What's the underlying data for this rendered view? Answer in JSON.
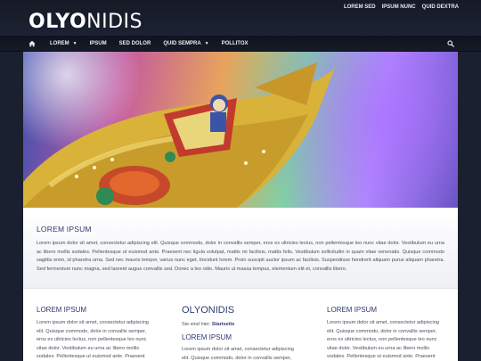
{
  "header": {
    "logo_bold": "OLYO",
    "logo_light": "NIDIS",
    "top_links": [
      "LOREM SED",
      "IPSUM NUNC",
      "QUID DEXTRA"
    ]
  },
  "nav": {
    "items": [
      {
        "label": "LOREM",
        "has_dropdown": true
      },
      {
        "label": "IPSUM",
        "has_dropdown": false
      },
      {
        "label": "SED DOLOR",
        "has_dropdown": false
      },
      {
        "label": "QUID SEMPRA",
        "has_dropdown": true
      },
      {
        "label": "POLLITOX",
        "has_dropdown": false
      }
    ],
    "home_icon": "home-icon",
    "search_icon": "search-icon"
  },
  "intro": {
    "heading": "LOREM IPSUM",
    "body": "Lorem ipsum dolor sit amet, consectetur adipiscing elit. Quisque commodo, dolor in convallis semper, eros ex ultricies lectus, non pellentesque leo nunc vitae dolor. Vestibulum eu urna ac libero mollis sodales. Pellentesque ut euismod ante. Praesent nec ligula volutpat, mattis mi facilisis, mattis felis. Vestibulum sollicitudin in quam vitae venenatis. Quisque commodo sagittis enim, id pharetra urna. Sed nec mauris tempor, varius nunc eget, tincidunt lorem. Proin suscipit auctor ipsum ac facilisis. Suspendisse hendrerit aliquam purus aliquam pharetra. Sed fermentum nunc magna, sed laoreet augue convallis sed. Donec a leo odio. Mauris ut massa tempus, elementum elit et, convallis libero."
  },
  "columns": {
    "left": {
      "heading": "LOREM IPSUM",
      "body": "Lorem ipsum dolor sit amet, consectetur adipiscing elit. Quisque commodo, dolor in convallis semper, eros ex ultricies lectus, non pellentesque leo nunc vitae dolor. Vestibulum eu urna ac libero mollis sodales. Pellentesque ut euismod ante. Praesent nec"
    },
    "middle": {
      "site_name": "OLYONIDIS",
      "breadcrumb_prefix": "Sie sind hier:",
      "breadcrumb_current": "Startseite",
      "heading": "LOREM IPSUM",
      "body": "Lorem ipsum dolor sit amet, consectetur adipiscing elit. Quisque commodo, dolor in convallis semper,"
    },
    "right": {
      "heading": "LOREM IPSUM",
      "body": "Lorem ipsum dolor sit amet, consectetur adipiscing elit. Quisque commodo, dolor in convallis semper, eros ex ultricies lectus, non pellentesque leo nunc vitae dolor. Vestibulum eu urna ac libero mollis sodales. Pellentesque ut euismod ante. Praesent nec"
    }
  },
  "colors": {
    "background": "#1b2030",
    "heading": "#2d3b70",
    "body_text": "#4b4f5a"
  }
}
